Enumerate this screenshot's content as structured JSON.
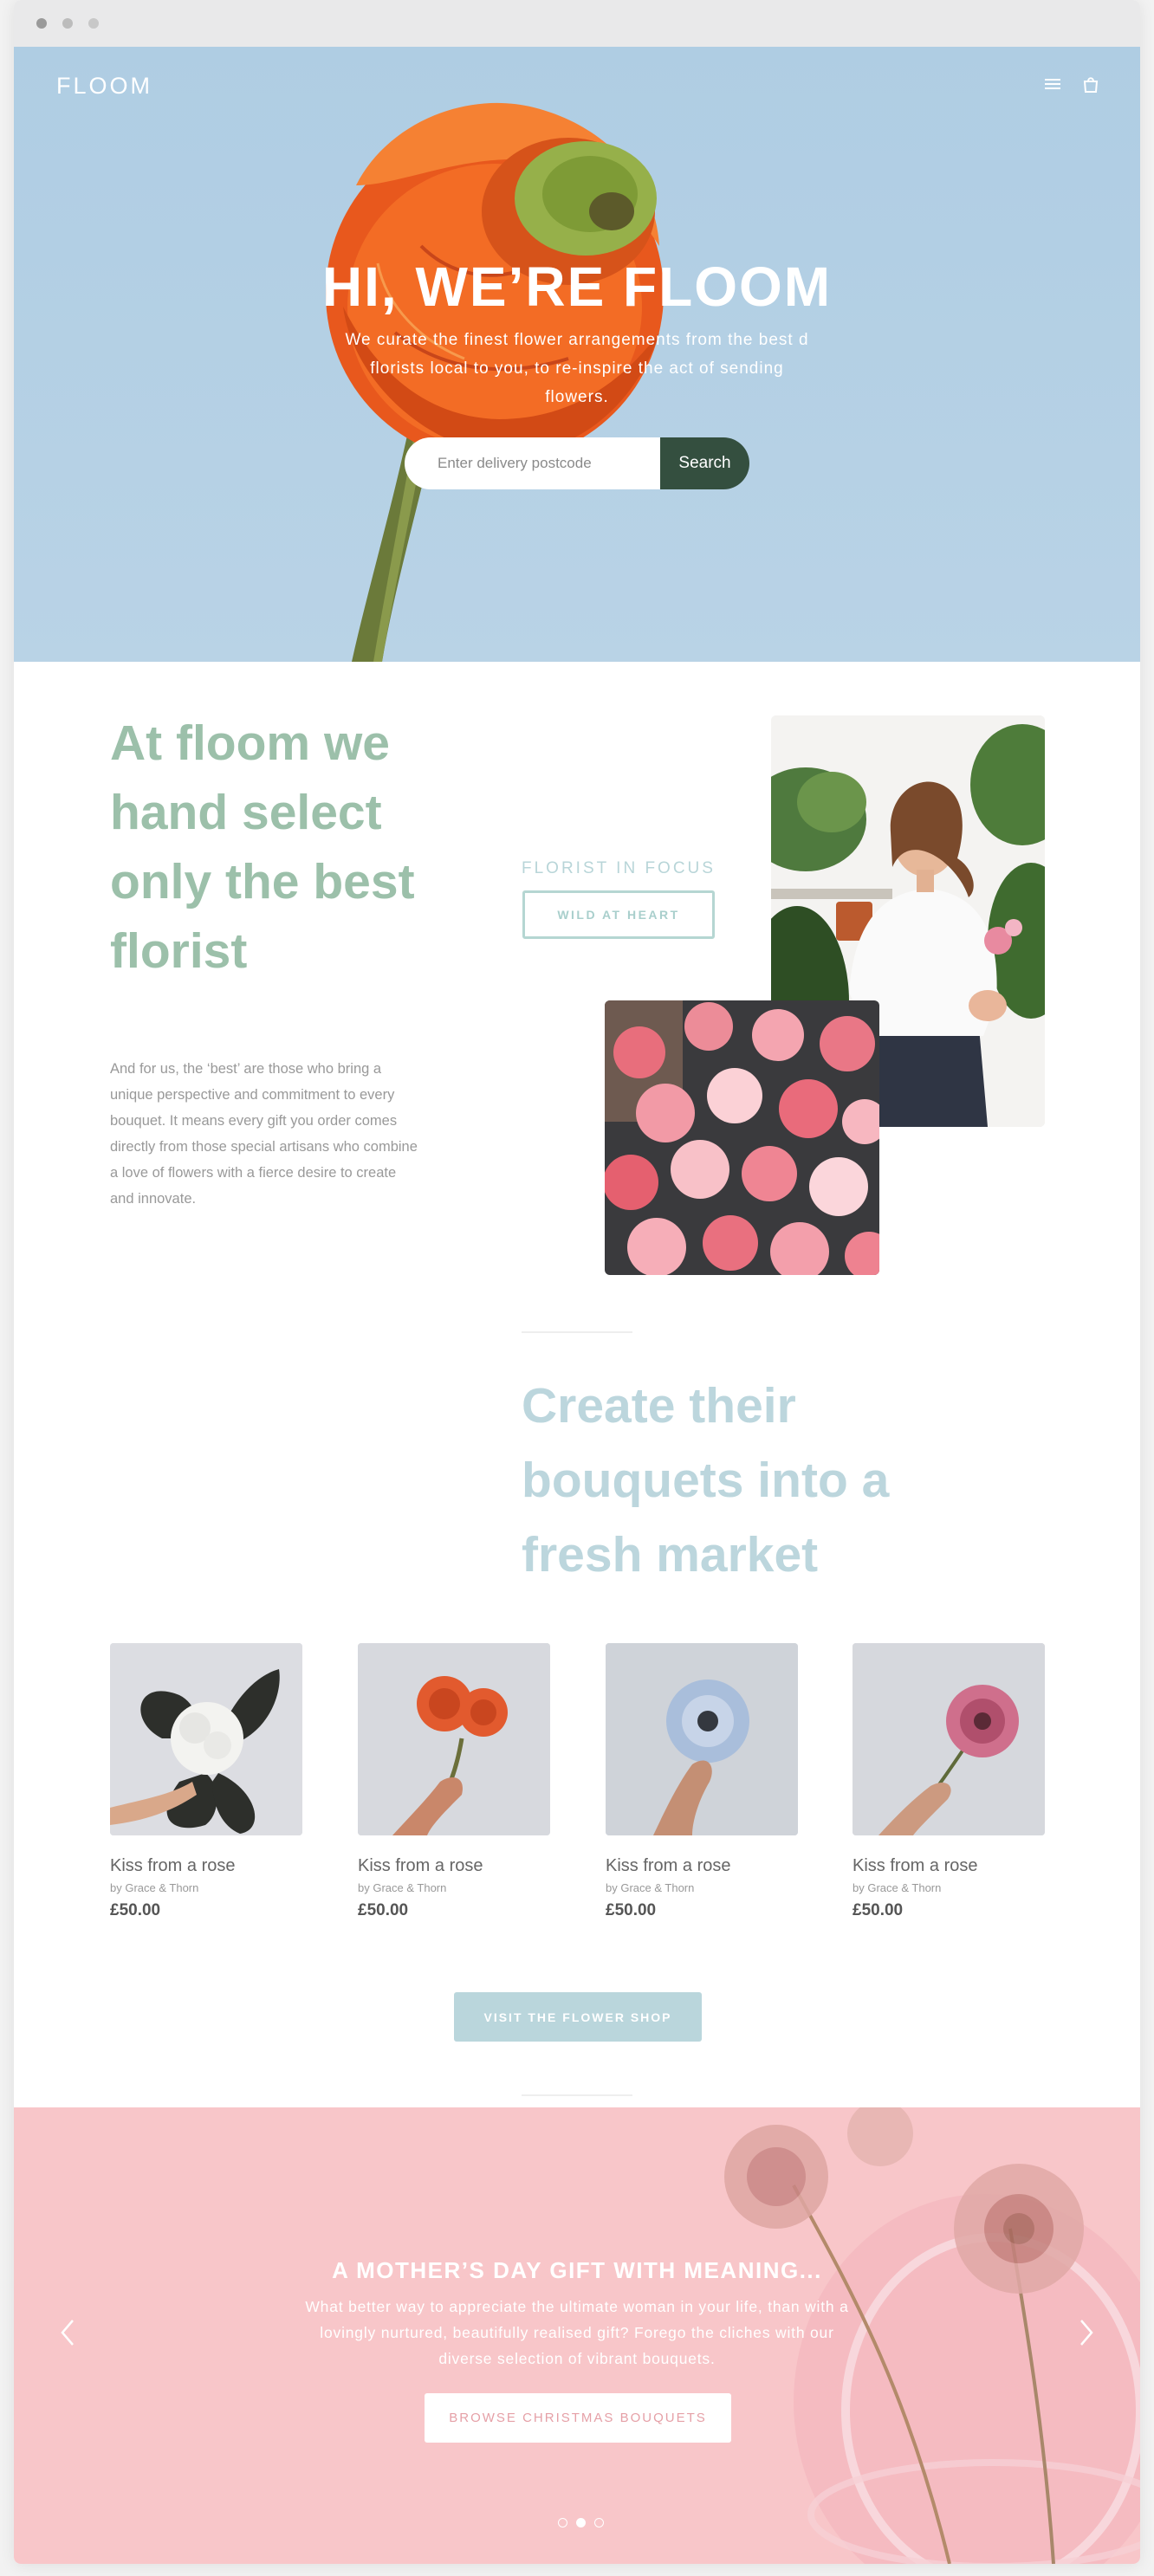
{
  "hero": {
    "logo": "FLOOM",
    "title": "HI, WE’RE FLOOM",
    "subtitle": "We curate the finest flower arrangements from the best d florists local to you, to re-inspire the act of sending flowers.",
    "search_placeholder": "Enter delivery postcode",
    "search_label": "Search"
  },
  "intro": {
    "heading": "At floom we hand select only the best florist",
    "body": "And for us, the ‘best’ are those who bring a unique perspective and commitment to every bouquet. It means every gift you order comes directly from those special artisans who combine a love of flowers with a fierce desire to create and innovate.",
    "focus_label": "FLORIST IN FOCUS",
    "focus_button": "WILD AT HEART"
  },
  "market": {
    "heading": "Create their bouquets into a fresh market"
  },
  "products": [
    {
      "name": "Kiss from a rose",
      "by": "by Grace & Thorn",
      "price": "£50.00",
      "flower": "#f3f3f0",
      "accent": "#2d2f2b"
    },
    {
      "name": "Kiss from a rose",
      "by": "by Grace & Thorn",
      "price": "£50.00",
      "flower": "#e25a2e",
      "accent": "#c9876a"
    },
    {
      "name": "Kiss from a rose",
      "by": "by Grace & Thorn",
      "price": "£50.00",
      "flower": "#a9bedb",
      "accent": "#34383f"
    },
    {
      "name": "Kiss from a rose",
      "by": "by Grace & Thorn",
      "price": "£50.00",
      "flower": "#cf6f8c",
      "accent": "#5b2a36"
    }
  ],
  "shop_button": "VISIT THE FLOWER SHOP",
  "banner": {
    "title": "A MOTHER’S DAY GIFT WITH MEANING...",
    "subtitle": "What better way to appreciate the ultimate woman in your life, than with a lovingly nurtured, beautifully realised gift? Forego the cliches with our diverse selection of vibrant bouquets.",
    "button": "BROWSE CHRISTMAS BOUQUETS",
    "active_slide": 2,
    "slide_count": 3
  },
  "colors": {
    "hero_bg": "#b3cfe4",
    "search_button": "#344f3f",
    "green_heading": "#9cc0aa",
    "blue_heading": "#bcd6dd",
    "banner_bg": "#f8c6c9"
  }
}
